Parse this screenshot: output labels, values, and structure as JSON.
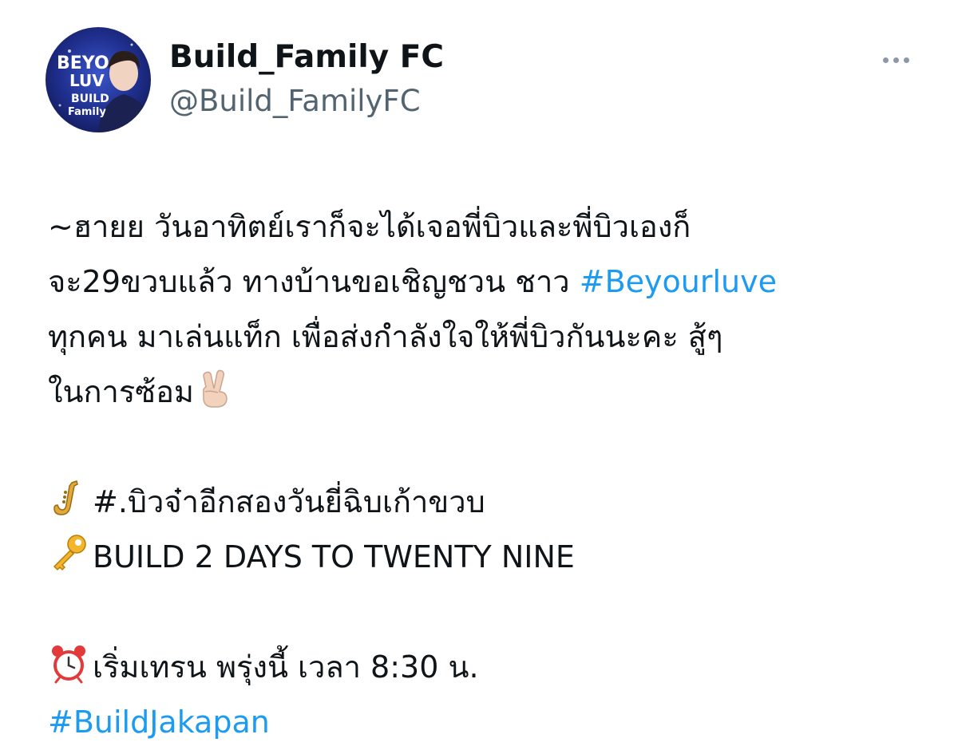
{
  "author": {
    "display_name": "Build_Family FC",
    "handle": "@Build_FamilyFC",
    "avatar_text_1": "BEYO",
    "avatar_text_2": "LUV",
    "avatar_text_3": "BUILD",
    "avatar_text_4": "Family"
  },
  "more_icon": "more-horizontal-icon",
  "tweet": {
    "line1": "~ฮายย วันอาทิตย์เราก็จะได้เจอพี่บิวและพี่บิวเองก็",
    "line2_prefix": "จะ29ขวบแล้ว ทางบ้านขอเชิญชวน ชาว ",
    "line2_hashtag": "#Beyourluve",
    "line3": "ทุกคน มาเล่นแท็ก เพื่อส่งกำลังใจให้พี่บิวกันนะคะ สู้ๆ",
    "line4": "ในการซ้อม",
    "line4_emoji": "victory-hand-emoji",
    "tag_emoji": "saxophone-emoji",
    "tag_line": "#.บิวจ๋าอีกสองวันยี่ฉิบเก้าขวบ",
    "en_emoji": "key-emoji",
    "en_line": "BUILD 2 DAYS TO TWENTY NINE",
    "time_emoji": "alarm-clock-emoji",
    "time_line": "เริ่มเทรน พรุ่งนี้ เวลา 8:30 น.",
    "final_hashtag": "#BuildJakapan"
  },
  "colors": {
    "text": "#0f1419",
    "secondary": "#536471",
    "link": "#1d9bf0"
  }
}
